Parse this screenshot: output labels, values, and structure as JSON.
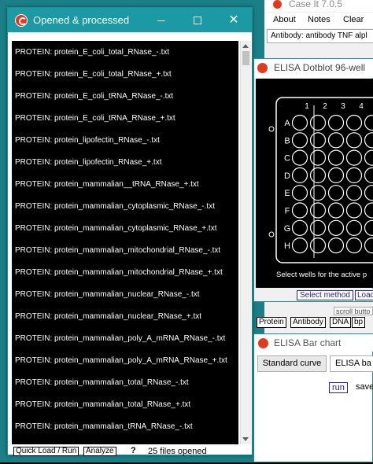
{
  "main_window": {
    "title": "Opened & processed",
    "files": [
      "PROTEIN: protein_E_coli_total_RNase_-.txt",
      "PROTEIN: protein_E_coli_total_RNase_+.txt",
      "PROTEIN: protein_E_coli_tRNA_RNase_-.txt",
      "PROTEIN: protein_E_coli_tRNA_RNase_+.txt",
      "PROTEIN: protein_lipofectin_RNase_-.txt",
      "PROTEIN: protein_lipofectin_RNase_+.txt",
      "PROTEIN: protein_mammalian__tRNA_RNase_+.txt",
      "PROTEIN: protein_mammalian_cytoplasmic_RNase_-.txt",
      "PROTEIN: protein_mammalian_cytoplasmic_RNase_+.txt",
      "PROTEIN: protein_mammalian_mitochondrial_RNase_-.txt",
      "PROTEIN: protein_mammalian_mitochondrial_RNase_+.txt",
      "PROTEIN: protein_mammalian_nuclear_RNase_-.txt",
      "PROTEIN: protein_mammalian_nuclear_RNase_+.txt",
      "PROTEIN: protein_mammalian_poly_A_mRNA_RNase_-.txt",
      "PROTEIN: protein_mammalian_poly_A_mRNA_RNase_+.txt",
      "PROTEIN: protein_mammalian_total_RNase_-.txt",
      "PROTEIN: protein_mammalian_total_RNase_+.txt",
      "PROTEIN: protein_mammalian_tRNA_RNase_-.txt"
    ],
    "quick_load_label": "Quick Load / Run",
    "analyze_label": "Analyze",
    "help_label": "?",
    "files_opened": "25  files opened"
  },
  "caseit_window": {
    "title": "Case It 7.0.5",
    "menu": [
      "About",
      "Notes",
      "Clear"
    ],
    "antibody_text": "Antibody: antibody TNF alpl"
  },
  "dotblot_window": {
    "title": "ELISA   Dotblot   96-well",
    "column_labels": [
      "1",
      "2",
      "3",
      "4"
    ],
    "row_labels": [
      "A",
      "B",
      "C",
      "D",
      "E",
      "F",
      "G",
      "H"
    ],
    "select_message": "Select wells for the active p",
    "select_method_label": "Select method",
    "load_label": "Load"
  },
  "scroll_button_label": "scroll butto",
  "tab_buttons": [
    "Protein",
    "Antibody",
    "DNA",
    "bp"
  ],
  "bar_chart_window": {
    "title": "ELISA Bar chart",
    "tab_standard": "Standard curve",
    "tab_bar": "ELISA ba",
    "run_label": "run",
    "save_label": "save"
  },
  "colors": {
    "desktop": "#1a7f86",
    "titlebar_active": "#1b9aa6",
    "list_background": "#000000",
    "app_icon": "#e23a1f"
  }
}
